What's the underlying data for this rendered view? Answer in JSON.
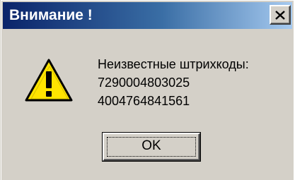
{
  "window": {
    "title": "Внимание !",
    "close_icon": "close-icon"
  },
  "message": {
    "icon": "warning-icon",
    "heading": "Неизвестные штрихкоды:",
    "barcodes": [
      "7290004803025",
      "4004764841561"
    ]
  },
  "buttons": {
    "ok_label": "OK"
  },
  "colors": {
    "titlebar_start": "#0a246a",
    "titlebar_end": "#a6caf0",
    "dialog_face": "#d4d0c8",
    "warning_fill": "#ffe400"
  }
}
